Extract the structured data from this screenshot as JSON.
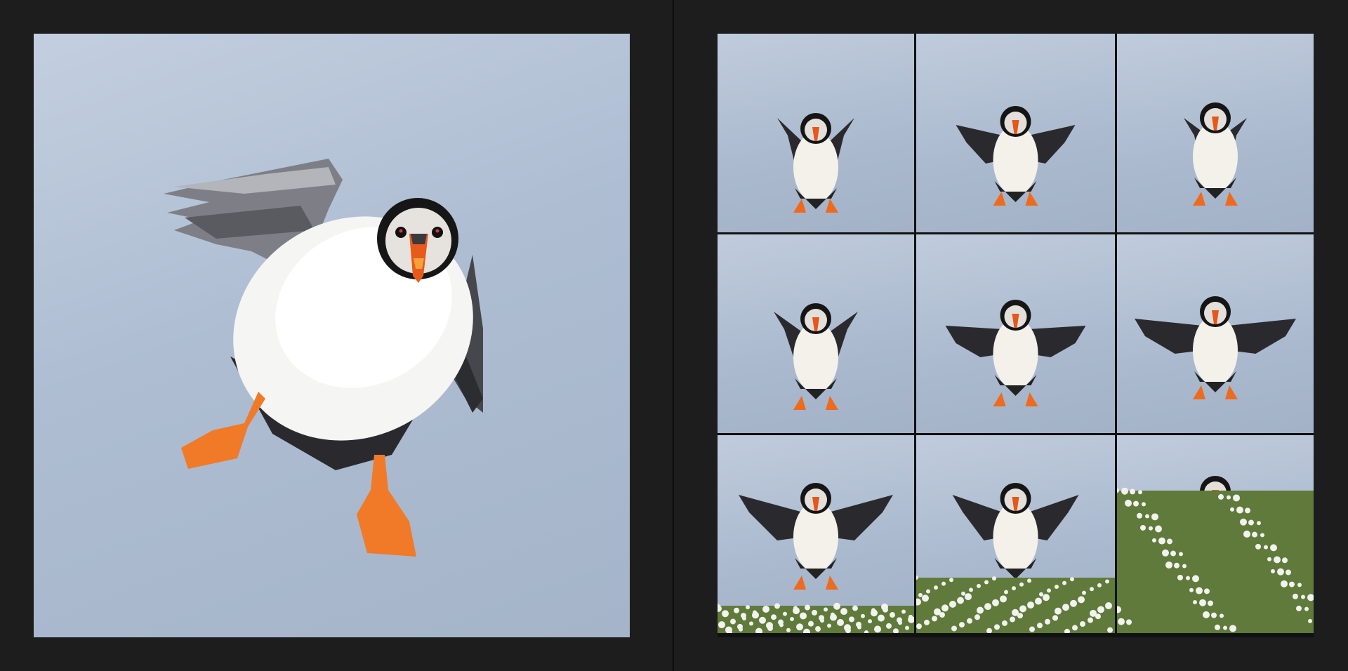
{
  "hero": {
    "icon": "puffin-landing-closeup-icon"
  },
  "grid": {
    "frames": [
      {
        "icon": "puffin-frame-1-icon",
        "flowers": false
      },
      {
        "icon": "puffin-frame-2-icon",
        "flowers": false
      },
      {
        "icon": "puffin-frame-3-icon",
        "flowers": false
      },
      {
        "icon": "puffin-frame-4-icon",
        "flowers": false
      },
      {
        "icon": "puffin-frame-5-icon",
        "flowers": false
      },
      {
        "icon": "puffin-frame-6-icon",
        "flowers": false
      },
      {
        "icon": "puffin-frame-7-icon",
        "flowers": true
      },
      {
        "icon": "puffin-frame-8-icon",
        "flowers": true
      },
      {
        "icon": "puffin-frame-9-icon",
        "flowers": true
      }
    ]
  },
  "colors": {
    "sky": "#aebdd2",
    "background": "#1d1d1d",
    "feet": "#ee6a1c",
    "flowers": "#f2f2ee"
  }
}
